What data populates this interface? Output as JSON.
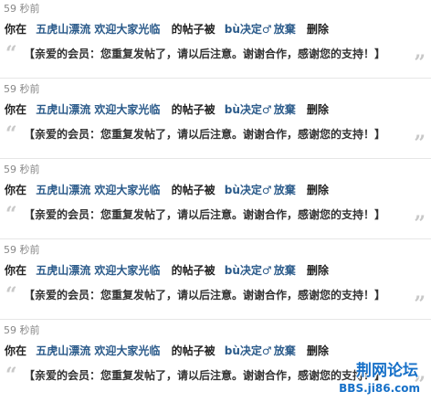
{
  "notices": [
    {
      "time": "59 秒前",
      "prefix": "你在",
      "thread_title": "五虎山漂流  欢迎大家光临",
      "middle": "的帖子被",
      "moderator": "bù决定",
      "gender_icon": "male-icon",
      "gender_symbol": "♂",
      "moderator_suffix": "放棄",
      "action": "删除",
      "message": "【亲爱的会员：您重复发帖了，请以后注意。谢谢合作，感谢您的支持！】"
    },
    {
      "time": "59 秒前",
      "prefix": "你在",
      "thread_title": "五虎山漂流  欢迎大家光临",
      "middle": "的帖子被",
      "moderator": "bù决定",
      "gender_icon": "male-icon",
      "gender_symbol": "♂",
      "moderator_suffix": "放棄",
      "action": "删除",
      "message": "【亲爱的会员：您重复发帖了，请以后注意。谢谢合作，感谢您的支持！】"
    },
    {
      "time": "59 秒前",
      "prefix": "你在",
      "thread_title": "五虎山漂流  欢迎大家光临",
      "middle": "的帖子被",
      "moderator": "bù决定",
      "gender_icon": "male-icon",
      "gender_symbol": "♂",
      "moderator_suffix": "放棄",
      "action": "删除",
      "message": "【亲爱的会员：您重复发帖了，请以后注意。谢谢合作，感谢您的支持！】"
    },
    {
      "time": "59 秒前",
      "prefix": "你在",
      "thread_title": "五虎山漂流  欢迎大家光临",
      "middle": "的帖子被",
      "moderator": "bù决定",
      "gender_icon": "male-icon",
      "gender_symbol": "♂",
      "moderator_suffix": "放棄",
      "action": "删除",
      "message": "【亲爱的会员：您重复发帖了，请以后注意。谢谢合作，感谢您的支持！】"
    },
    {
      "time": "59 秒前",
      "prefix": "你在",
      "thread_title": "五虎山漂流  欢迎大家光临",
      "middle": "的帖子被",
      "moderator": "bù决定",
      "gender_icon": "male-icon",
      "gender_symbol": "♂",
      "moderator_suffix": "放棄",
      "action": "删除",
      "message": "【亲爱的会员：您重复发帖了，请以后注意。谢谢合作，感谢您的支持！】"
    }
  ],
  "quote_open": "“",
  "quote_close": "”",
  "watermark": {
    "title": "荆网论坛",
    "url": "BBS.ji86.com"
  },
  "colors": {
    "link": "#2a5a8a",
    "watermark": "#1670c8",
    "quote_mark": "#c8c8c8"
  }
}
